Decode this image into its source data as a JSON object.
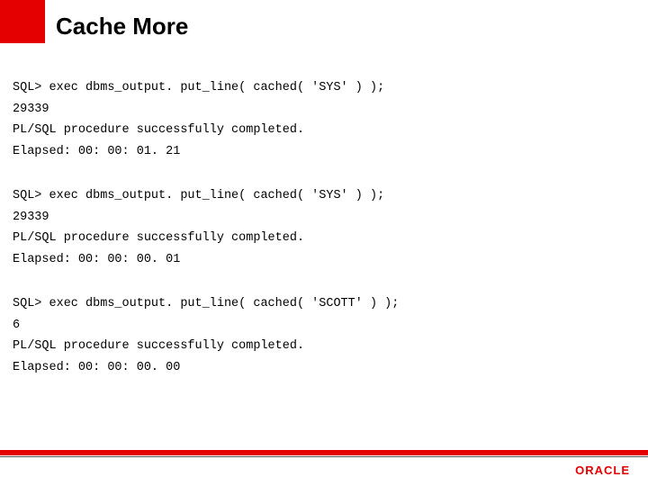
{
  "title": "Cache More",
  "blocks": [
    {
      "cmd": "SQL> exec dbms_output. put_line( cached( 'SYS' ) );",
      "result": "29339",
      "status": "PL/SQL procedure successfully completed.",
      "elapsed": "Elapsed: 00: 00: 01. 21"
    },
    {
      "cmd": "SQL> exec dbms_output. put_line( cached( 'SYS' ) );",
      "result": "29339",
      "status": "PL/SQL procedure successfully completed.",
      "elapsed": "Elapsed: 00: 00: 00. 01"
    },
    {
      "cmd": "SQL> exec dbms_output. put_line( cached( 'SCOTT' ) );",
      "result": "6",
      "status": "PL/SQL procedure successfully completed.",
      "elapsed": "Elapsed: 00: 00: 00. 00"
    }
  ],
  "logo": "ORACLE"
}
